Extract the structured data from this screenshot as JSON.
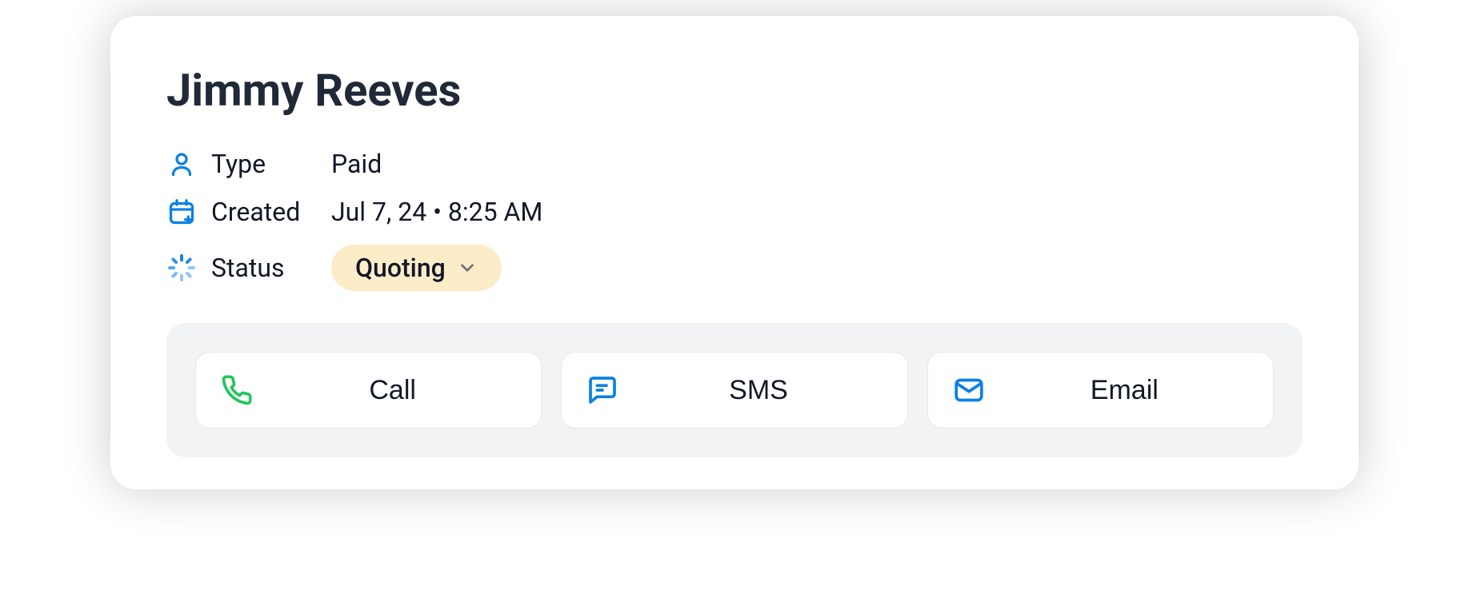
{
  "contact": {
    "name": "Jimmy Reeves",
    "meta": {
      "type_label": "Type",
      "type_value": "Paid",
      "created_label": "Created",
      "created_value": "Jul 7, 24 • 8:25 AM",
      "status_label": "Status",
      "status_value": "Quoting"
    }
  },
  "actions": {
    "call": "Call",
    "sms": "SMS",
    "email": "Email"
  }
}
